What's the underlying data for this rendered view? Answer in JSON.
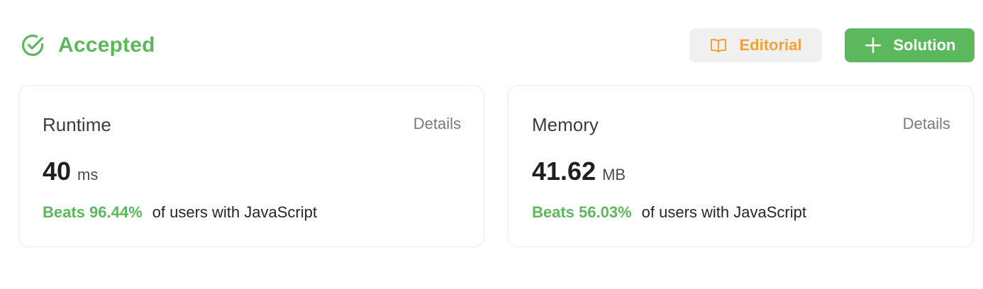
{
  "status": {
    "label": "Accepted",
    "icon": "check-circle-icon",
    "color": "#5cb85c"
  },
  "actions": {
    "editorial": {
      "label": "Editorial",
      "icon": "book-open-icon",
      "color": "#f0a437"
    },
    "solution": {
      "label": "Solution",
      "icon": "plus-icon",
      "color": "#5cb85c"
    }
  },
  "runtime": {
    "title": "Runtime",
    "details_label": "Details",
    "value": "40",
    "unit": "ms",
    "beats": "Beats 96.44%",
    "suffix": "of users with JavaScript"
  },
  "memory": {
    "title": "Memory",
    "details_label": "Details",
    "value": "41.62",
    "unit": "MB",
    "beats": "Beats 56.03%",
    "suffix": "of users with JavaScript"
  }
}
